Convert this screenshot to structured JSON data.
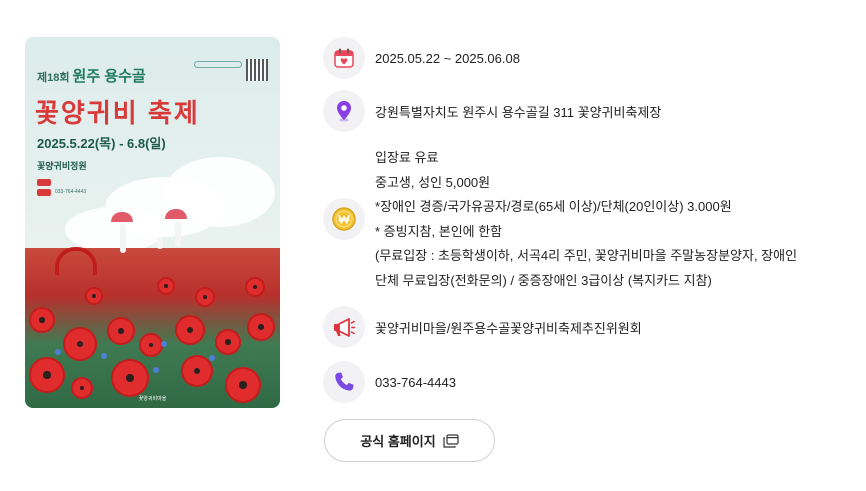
{
  "poster": {
    "edition": "제18회",
    "title_line1": "원주 용수골",
    "title_line2": "꽃양귀비 축제",
    "date": "2025.5.22(목) - 6.8(일)",
    "venue": "꽃양귀비정원",
    "phone": "033-764-4443",
    "host": "꽃양귀비마을"
  },
  "info": {
    "date_range": "2025.05.22 ~ 2025.06.08",
    "address": "강원특별자치도 원주시 용수골길 311  꽃양귀비축제장",
    "fee_lines": [
      "입장료 유료",
      "중고생, 성인 5,000원",
      "*장애인 경증/국가유공자/경로(65세 이상)/단체(20인이상) 3.000원",
      "* 증빙지참, 본인에 한함",
      "(무료입장 : 초등학생이하, 서곡4리 주민, 꽃양귀비마을 주말농장분양자, 장애인",
      "단체 무료입장(전화문의) / 중증장애인 3급이상 (복지카드 지참)"
    ],
    "organizer": "꽃양귀비마을/원주용수골꽃양귀비축제추진위원회",
    "phone": "033-764-4443"
  },
  "homepage_button": {
    "label": "공식 홈페이지"
  },
  "icons": {
    "calendar": "calendar-icon",
    "location": "location-pin-icon",
    "fee": "won-coin-icon",
    "organizer": "megaphone-icon",
    "phone": "phone-icon",
    "external": "external-link-icon"
  },
  "colors": {
    "icon_bg": "#f2f2f4",
    "calendar_red": "#e8475a",
    "pin_purple": "#8a3ee6",
    "coin_yellow": "#f2c230",
    "megaphone_red": "#e0323c",
    "phone_purple": "#7b4ae6"
  }
}
